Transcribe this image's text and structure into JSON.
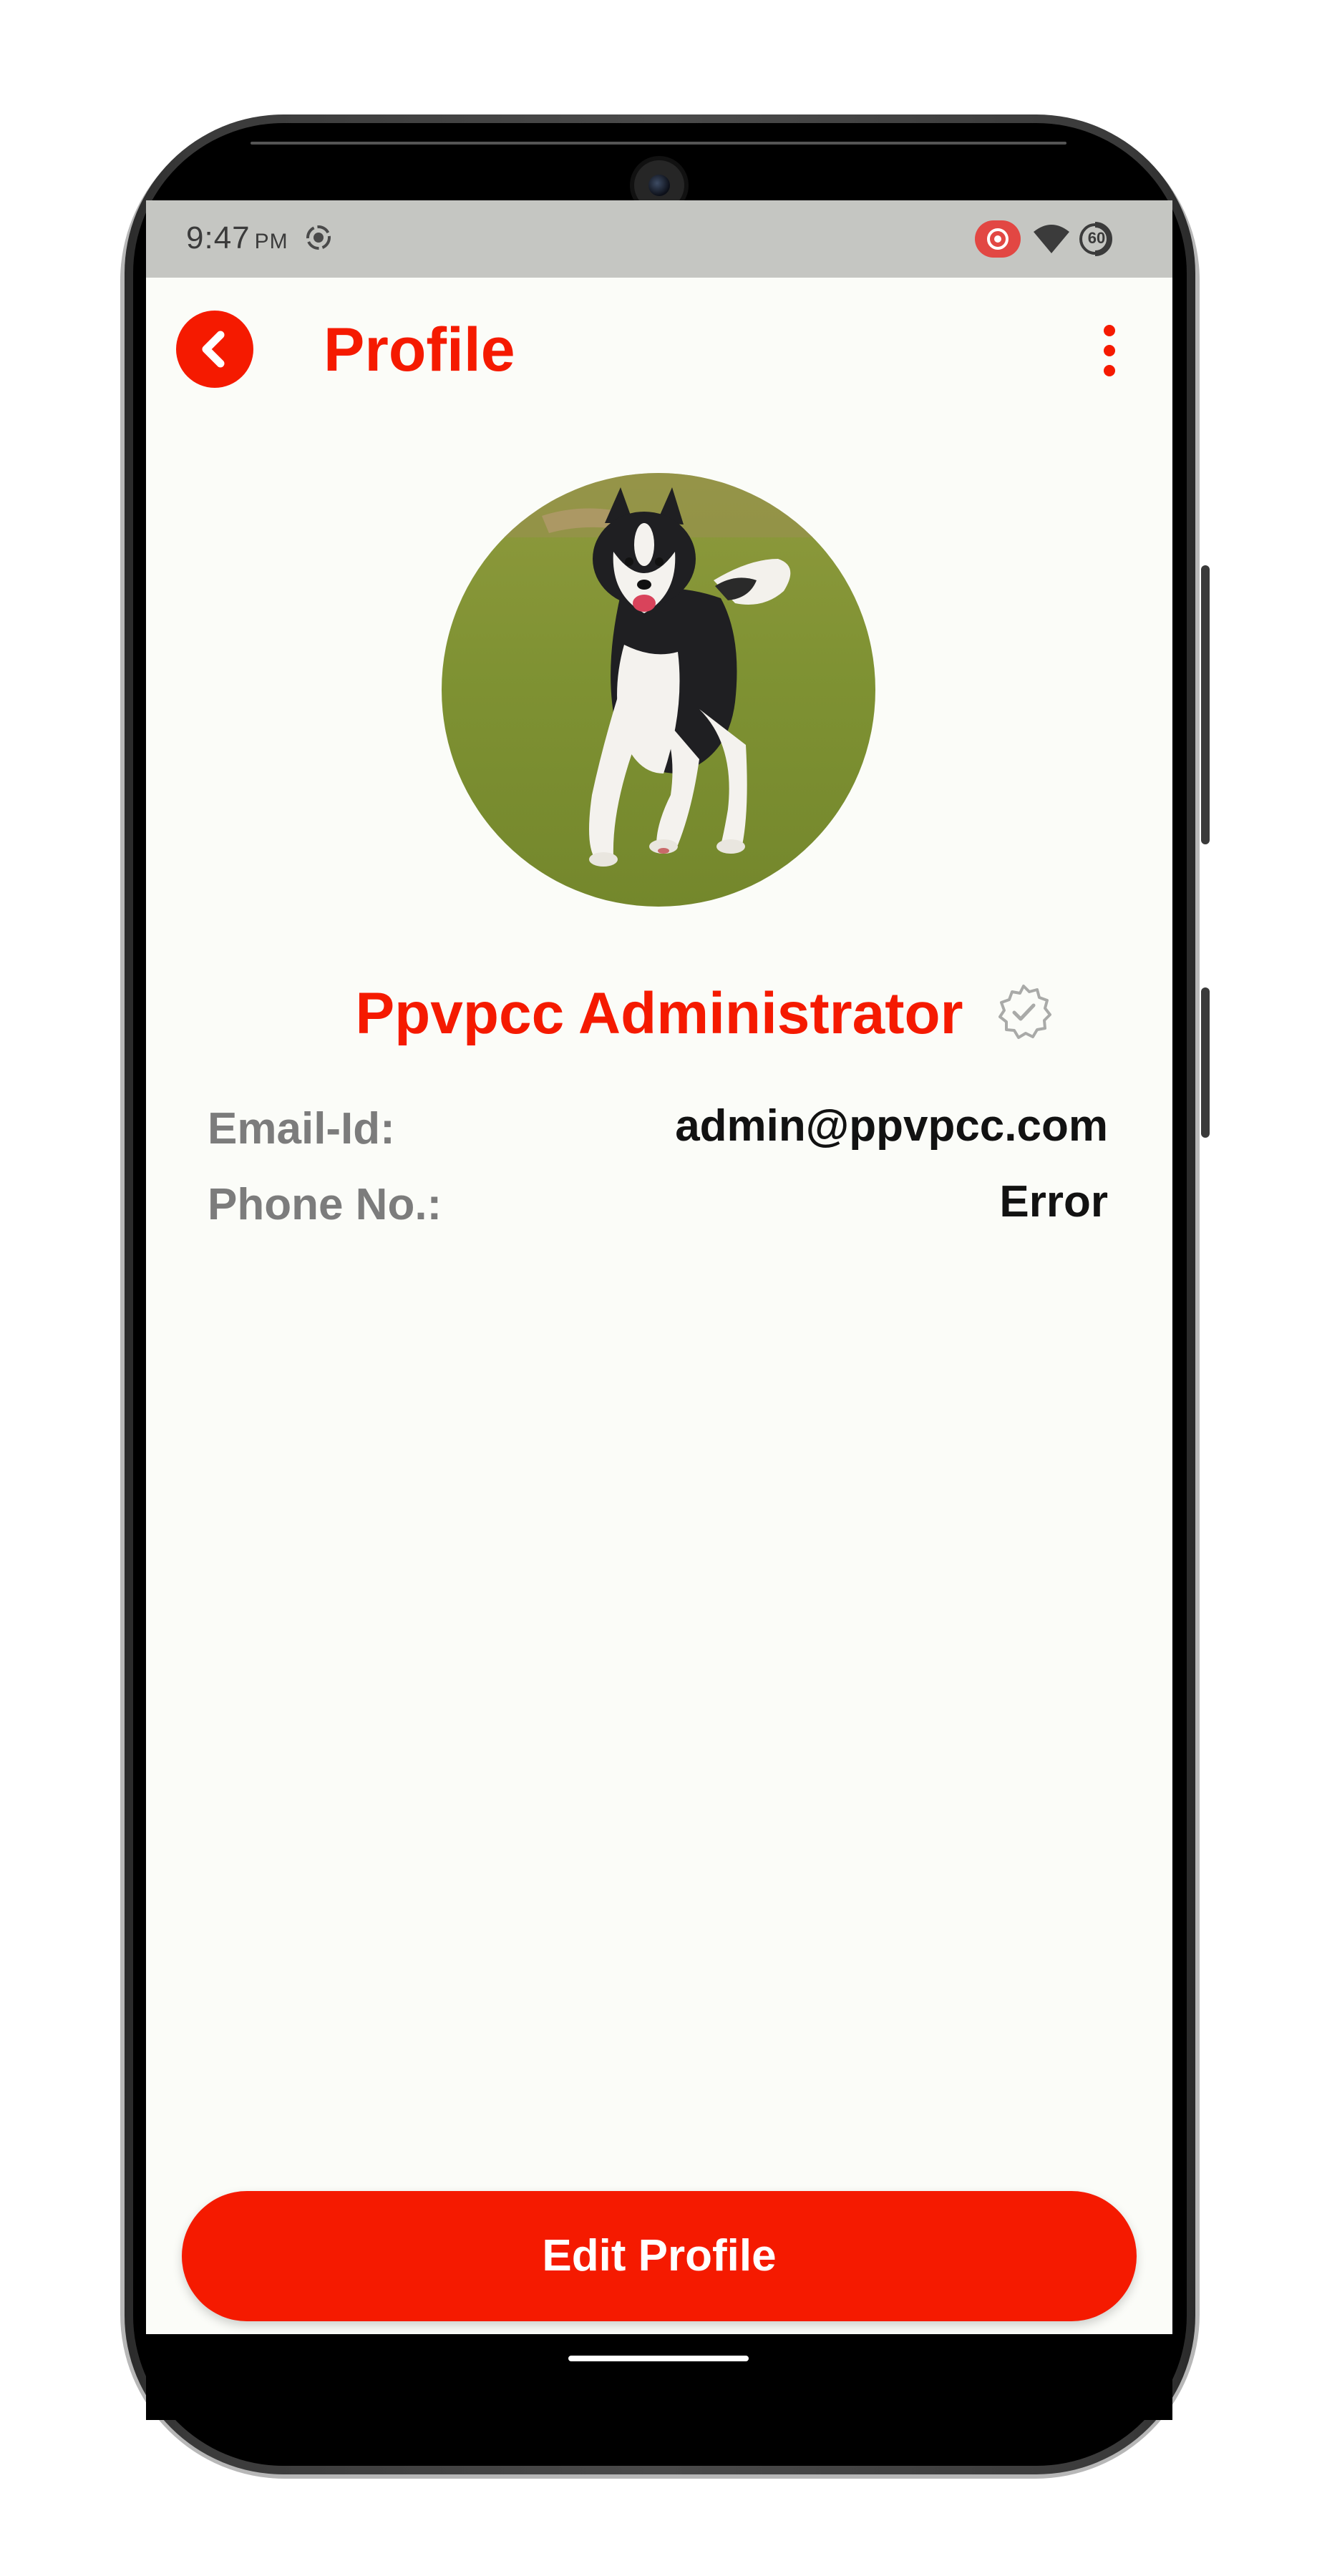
{
  "status_bar": {
    "time": "9:47",
    "ampm": "PM",
    "battery_label": "60",
    "icons": [
      "screen-record-icon",
      "cast-icon",
      "wifi-icon",
      "battery-icon"
    ]
  },
  "app_bar": {
    "title": "Profile",
    "back_icon": "chevron-left-icon",
    "menu_icon": "more-vertical-icon",
    "accent_color": "#f51a00"
  },
  "profile": {
    "avatar": "husky-dog-photo",
    "name": "Ppvpcc Administrator",
    "verified_icon": "verified-badge-icon",
    "details": [
      {
        "label": "Email-Id:",
        "value": "admin@ppvpcc.com"
      },
      {
        "label": "Phone No.:",
        "value": "Error"
      }
    ]
  },
  "actions": {
    "edit_label": "Edit Profile"
  }
}
